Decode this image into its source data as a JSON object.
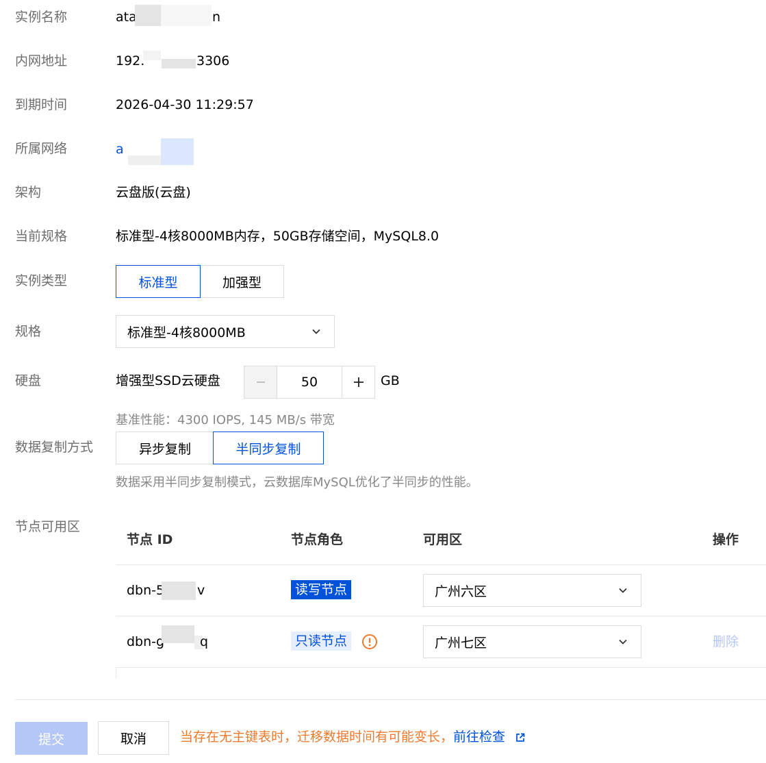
{
  "fields": {
    "instance_name": {
      "label": "实例名称",
      "value_prefix": "ata",
      "value_suffix": "n"
    },
    "internal_address": {
      "label": "内网地址",
      "value_prefix": "192.",
      "value_suffix": "3306"
    },
    "expire_time": {
      "label": "到期时间",
      "value": "2026-04-30 11:29:57"
    },
    "network": {
      "label": "所属网络",
      "value_prefix": "a"
    },
    "architecture": {
      "label": "架构",
      "value": "云盘版(云盘)"
    },
    "current_spec": {
      "label": "当前规格",
      "value": "标准型-4核8000MB内存，50GB存储空间，MySQL8.0"
    }
  },
  "instance_type": {
    "label": "实例类型",
    "options": [
      "标准型",
      "加强型"
    ],
    "selected": "标准型"
  },
  "spec": {
    "label": "规格",
    "selected": "标准型-4核8000MB"
  },
  "disk": {
    "label": "硬盘",
    "type": "增强型SSD云硬盘",
    "value": "50",
    "unit": "GB",
    "perf_hint": "基准性能：4300 IOPS, 145 MB/s 带宽"
  },
  "replication": {
    "label": "数据复制方式",
    "options": [
      "异步复制",
      "半同步复制"
    ],
    "selected": "半同步复制",
    "hint": "数据采用半同步复制模式，云数据库MySQL优化了半同步的性能。"
  },
  "nodes": {
    "label": "节点可用区",
    "columns": [
      "节点 ID",
      "节点角色",
      "可用区",
      "操作"
    ],
    "rows": [
      {
        "id_prefix": "dbn-5r",
        "id_suffix": "v",
        "role": "读写节点",
        "zone": "广州六区",
        "action": ""
      },
      {
        "id_prefix": "dbn-g",
        "id_suffix": "q",
        "role": "只读节点",
        "zone": "广州七区",
        "action": "删除"
      }
    ]
  },
  "footer": {
    "submit": "提交",
    "cancel": "取消",
    "warning": "当存在无主键表时，迁移数据时间有可能变长，",
    "check_link": "前往检查"
  },
  "colors": {
    "primary": "#0052d9",
    "warning": "#ed7b2f",
    "disabled_button": "#b5c7f7",
    "label_gray": "#6e6e6e",
    "readonly_tag_bg": "#e6edfb"
  },
  "icons": {
    "chevron": "chevron-down-icon",
    "warning": "warning-circle-icon",
    "external": "external-link-icon"
  }
}
